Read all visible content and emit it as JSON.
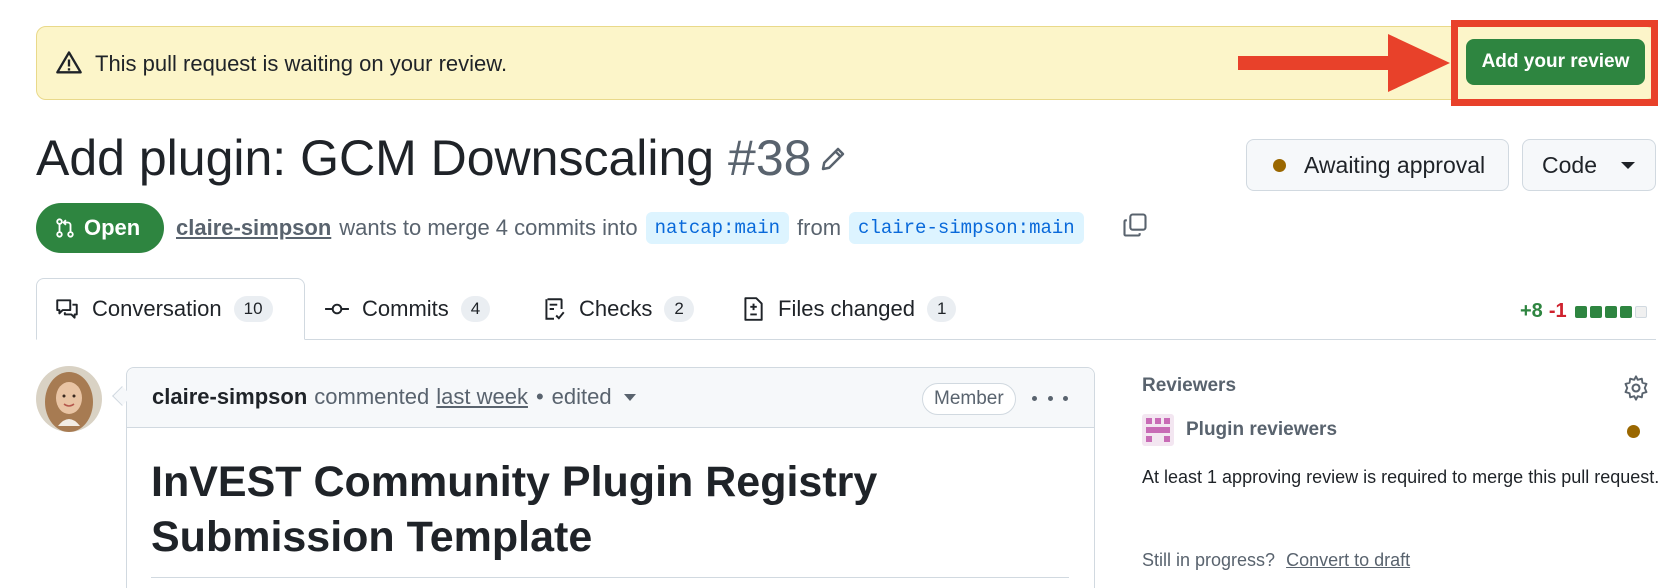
{
  "banner": {
    "text": "This pull request is waiting on your review.",
    "action_label": "Add your review",
    "annotation_color": "#e8412a"
  },
  "pr": {
    "title": "Add plugin: GCM Downscaling",
    "number": "#38",
    "state": "Open",
    "author": "claire-simpson",
    "merge_text": "wants to merge 4 commits into",
    "base_branch": "natcap:main",
    "from_text": "from",
    "head_branch": "claire-simpson:main",
    "status_button": "Awaiting approval",
    "code_button": "Code"
  },
  "tabs": [
    {
      "label": "Conversation",
      "count": "10",
      "icon": "conversation-icon"
    },
    {
      "label": "Commits",
      "count": "4",
      "icon": "commit-icon"
    },
    {
      "label": "Checks",
      "count": "2",
      "icon": "checks-icon"
    },
    {
      "label": "Files changed",
      "count": "1",
      "icon": "file-diff-icon"
    }
  ],
  "diffstat": {
    "additions": "+8",
    "deletions": "-1"
  },
  "comment": {
    "author": "claire-simpson",
    "action": "commented",
    "time": "last week",
    "separator": "•",
    "edited": "edited",
    "role_badge": "Member",
    "heading": "InVEST Community Plugin Registry Submission Template"
  },
  "sidebar": {
    "heading": "Reviewers",
    "team": "Plugin reviewers",
    "note": "At least 1 approving review is required to merge this pull request.",
    "progress_text": "Still in progress?",
    "progress_link": "Convert to draft"
  },
  "colors": {
    "primary_green": "#2e8540",
    "pending": "#9a6700",
    "link_blue": "#0969da"
  }
}
